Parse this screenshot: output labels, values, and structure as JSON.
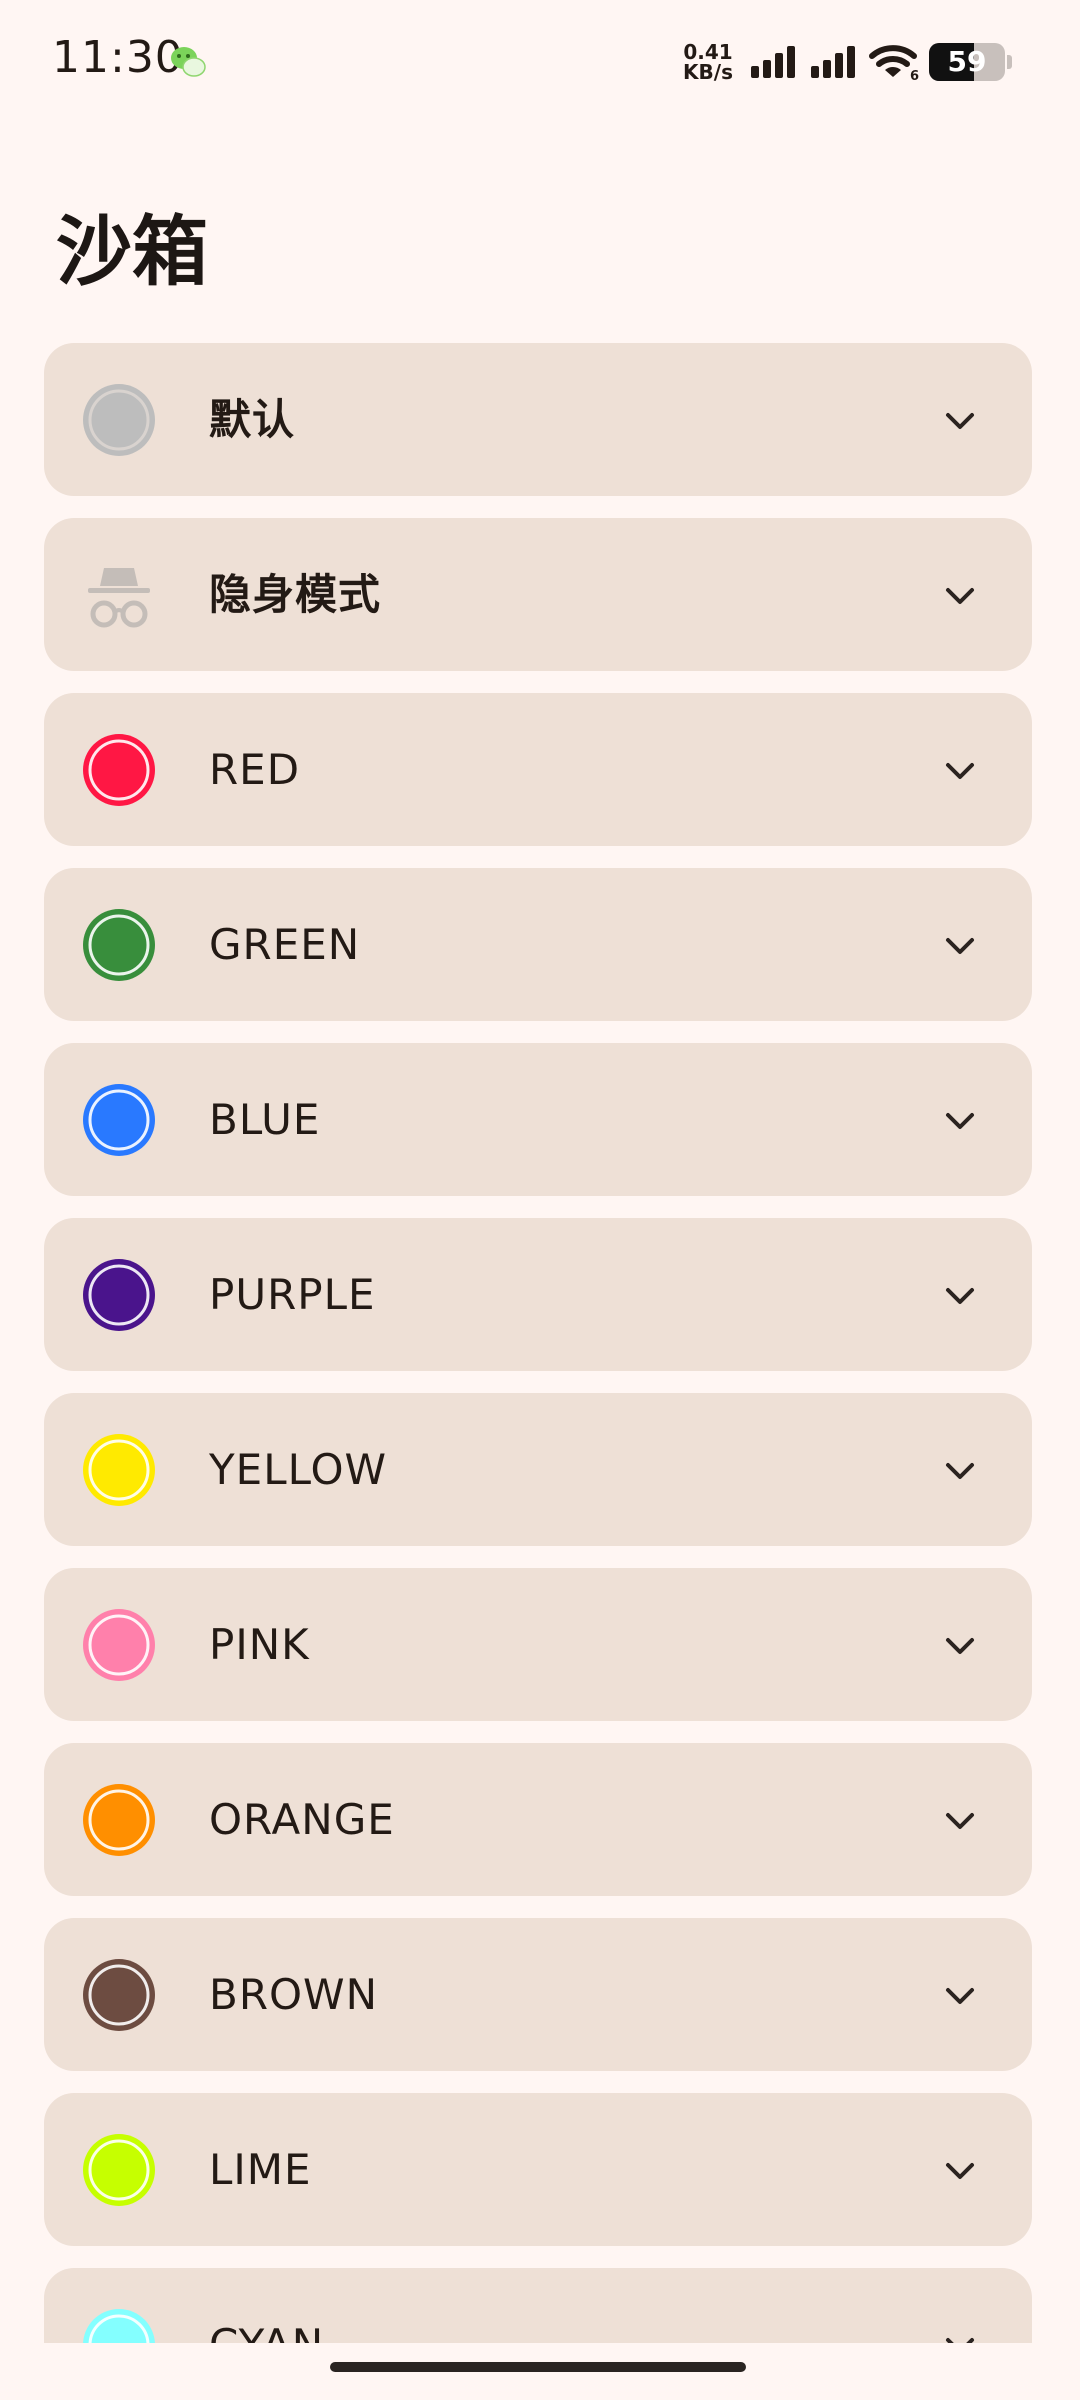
{
  "status_bar": {
    "time": "11:30",
    "net_speed_value": "0.41",
    "net_speed_unit": "KB/s",
    "wifi_badge": "6",
    "battery": "59",
    "battery_level": 0.59,
    "icons": [
      "wechat-icon",
      "signal-icon",
      "signal-icon",
      "wifi-icon",
      "battery-icon"
    ]
  },
  "page": {
    "title": "沙箱"
  },
  "sandboxes": [
    {
      "label": "默认",
      "icon": "default-gray-circle-icon",
      "color": "#bdbdbd"
    },
    {
      "label": "隐身模式",
      "icon": "incognito-icon",
      "color": "#c4bdb8"
    },
    {
      "label": "RED",
      "icon": "red-circle-icon",
      "color": "#ff1744"
    },
    {
      "label": "GREEN",
      "icon": "green-circle-icon",
      "color": "#388e3c"
    },
    {
      "label": "BLUE",
      "icon": "blue-circle-icon",
      "color": "#2979ff"
    },
    {
      "label": "PURPLE",
      "icon": "purple-circle-icon",
      "color": "#4a148c"
    },
    {
      "label": "YELLOW",
      "icon": "yellow-circle-icon",
      "color": "#ffea00"
    },
    {
      "label": "PINK",
      "icon": "pink-circle-icon",
      "color": "#ff80ab"
    },
    {
      "label": "ORANGE",
      "icon": "orange-circle-icon",
      "color": "#ff8f00"
    },
    {
      "label": "BROWN",
      "icon": "brown-circle-icon",
      "color": "#6d4c41"
    },
    {
      "label": "LIME",
      "icon": "lime-circle-icon",
      "color": "#c6ff00"
    },
    {
      "label": "CYAN",
      "icon": "cyan-circle-icon",
      "color": "#84ffff"
    }
  ],
  "expand_icon": "chevron-down-icon"
}
